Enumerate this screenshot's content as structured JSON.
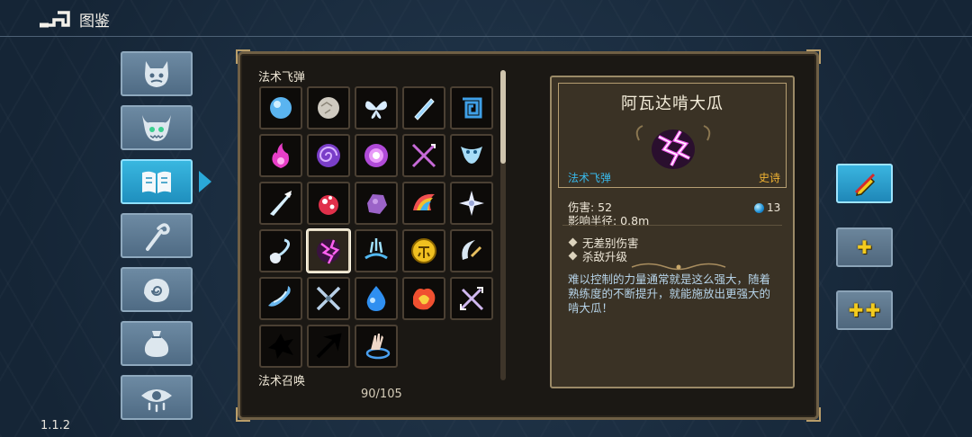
{
  "header": {
    "title": "图鉴",
    "back_icon": "back-arrow-icon"
  },
  "sidebar": {
    "items": [
      {
        "icon": "demon-face-icon",
        "active": false
      },
      {
        "icon": "horned-mask-icon",
        "active": false
      },
      {
        "icon": "open-book-icon",
        "active": true
      },
      {
        "icon": "staff-icon",
        "active": false
      },
      {
        "icon": "hand-spiral-icon",
        "active": false
      },
      {
        "icon": "pouch-icon",
        "active": false
      },
      {
        "icon": "eye-icon",
        "active": false
      }
    ]
  },
  "catalog": {
    "section_label": "法术飞弹",
    "next_section_label": "法术召唤",
    "counter": "90/105",
    "spells": [
      "blue-orb-icon",
      "stone-ball-icon",
      "butterfly-icon",
      "ice-bolt-icon",
      "spiral-square-icon",
      "pink-flame-icon",
      "purple-vortex-icon",
      "violet-sphere-icon",
      "crossed-arrows-icon",
      "ice-serpent-icon",
      "frost-spear-icon",
      "red-spore-icon",
      "purple-rock-icon",
      "rainbow-wing-icon",
      "star-shuriken-icon",
      "wind-blast-icon",
      "lightning-melon-icon",
      "water-splash-icon",
      "gold-coin-icon",
      "crescent-blade-icon",
      "crescent-wave-icon",
      "crossed-blades-icon",
      "water-drop-icon",
      "fire-burst-icon",
      "crossed-swords-icon",
      "shadow-splat-icon",
      "dark-arrow-icon",
      "summon-hand-icon"
    ],
    "selected_index": 16
  },
  "detail": {
    "name": "阿瓦达啃大瓜",
    "type": "法术飞弹",
    "rarity": "史诗",
    "damage": "伤害: 52",
    "radius": "影响半径: 0.8m",
    "mana": "13",
    "traits": [
      "无差别伤害",
      "杀敌升级"
    ],
    "description": "难以控制的力量通常就是这么强大，随着熟练度的不断提升，就能施放出更强大的啃大瓜！",
    "accent_type": "#39b7e8",
    "accent_rarity": "#f0b232"
  },
  "right_buttons": [
    {
      "icon": "pencil-crossed-icon"
    },
    {
      "icon": "plus-icon"
    },
    {
      "icon": "double-plus-icon"
    }
  ],
  "version": "1.1.2"
}
